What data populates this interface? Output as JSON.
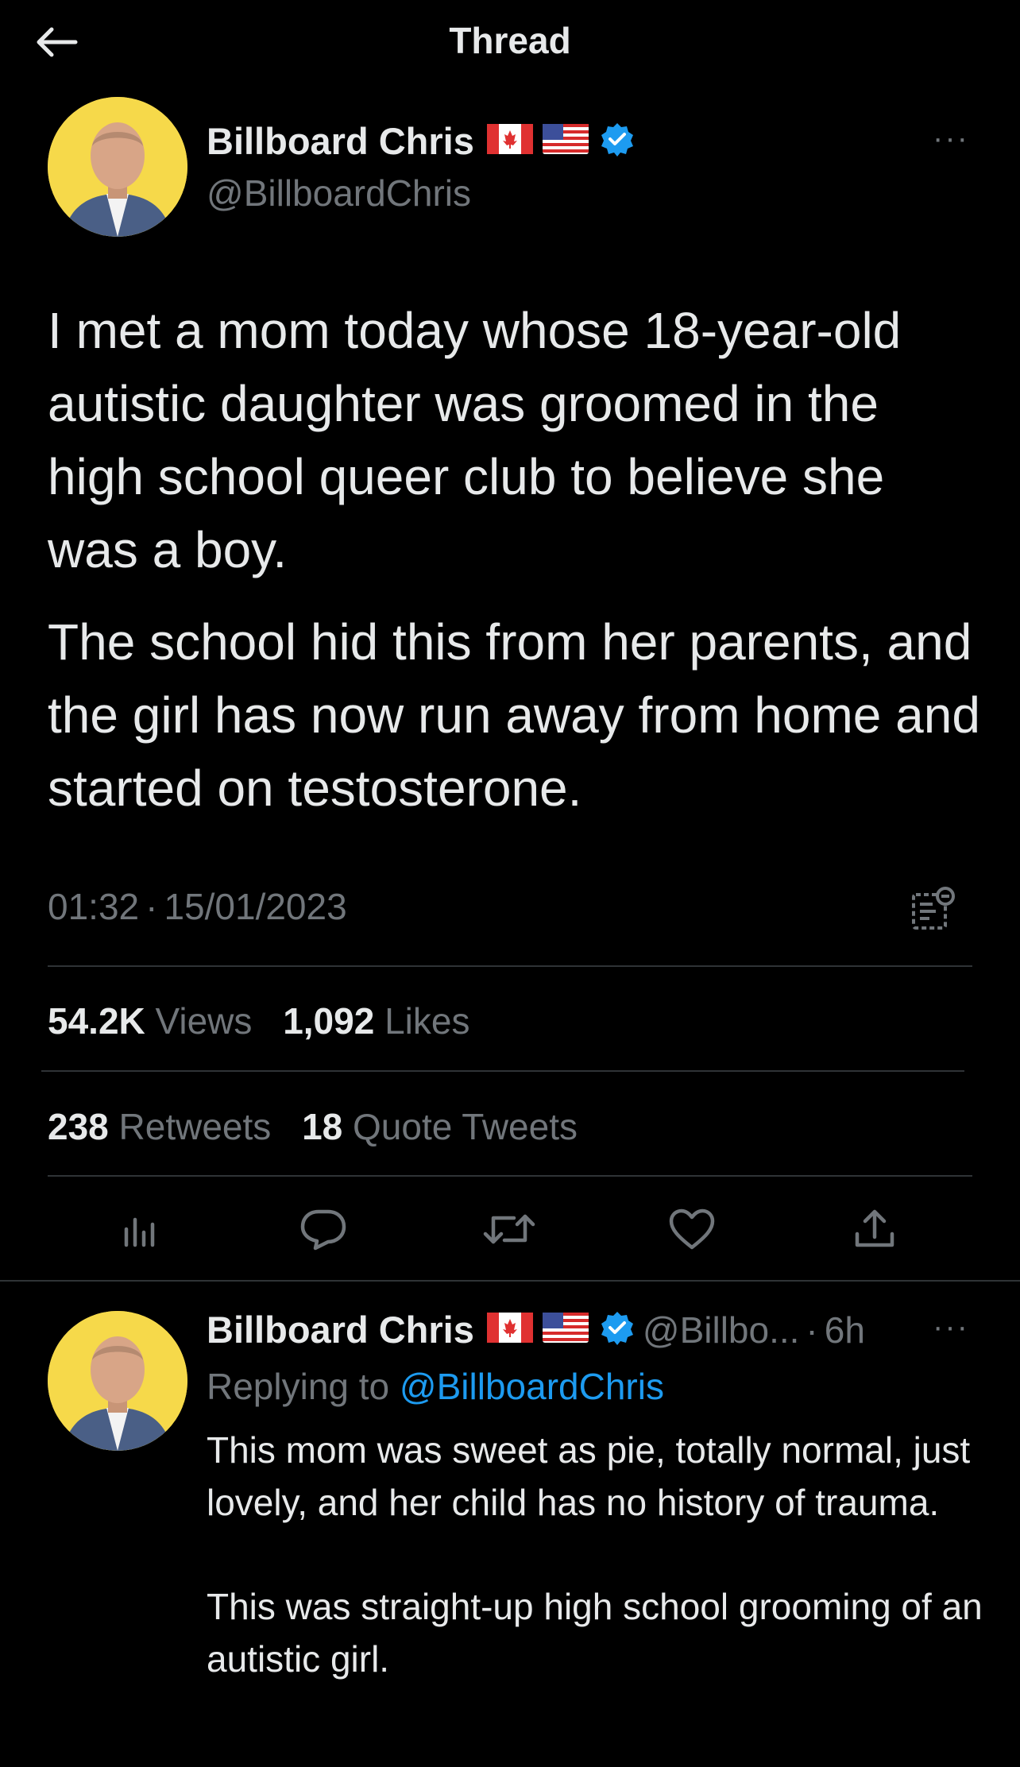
{
  "header": {
    "back_icon": "arrow-left-icon",
    "title": "Thread"
  },
  "main_tweet": {
    "author_name": "Billboard Chris",
    "flags": [
      "canada-flag-icon",
      "usa-flag-icon"
    ],
    "verified_icon": "verified-badge-icon",
    "handle": "@BillboardChris",
    "more_icon": "more-options-icon",
    "more_glyph": "···",
    "paragraphs": [
      "I met a mom today whose 18-year-old autistic daughter was groomed in the high school queer club to believe she was a boy.",
      "The school hid this from her parents, and the girl has now run away from home and started on testosterone."
    ],
    "time": "01:32",
    "separator": "·",
    "date": "15/01/2023",
    "analytics_icon": "tweet-analytics-icon",
    "stats": {
      "views_count": "54.2K",
      "views_label": "Views",
      "likes_count": "1,092",
      "likes_label": "Likes",
      "retweets_count": "238",
      "retweets_label": "Retweets",
      "quotes_count": "18",
      "quotes_label": "Quote Tweets"
    },
    "actions": [
      "views-icon",
      "reply-icon",
      "retweet-icon",
      "like-icon",
      "share-icon"
    ]
  },
  "reply_tweet": {
    "author_name": "Billboard Chris",
    "handle": "@Billbo...",
    "separator": "·",
    "age": "6h",
    "more_glyph": "···",
    "replying_prefix": "Replying to ",
    "replying_mention": "@BillboardChris",
    "paragraphs": [
      "This mom was sweet as pie, totally normal, just lovely, and her child has no history of trauma.",
      "This was straight-up high school grooming of an autistic girl."
    ]
  },
  "colors": {
    "background": "#000000",
    "text": "#e7e9ea",
    "muted": "#71767b",
    "accent": "#1d9bf0",
    "divider": "#2f3336"
  }
}
